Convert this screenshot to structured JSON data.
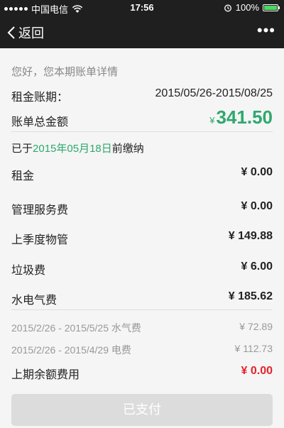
{
  "status_bar": {
    "carrier": "中国电信",
    "time": "17:56",
    "battery_percent": "100%",
    "battery_level": 1.0,
    "icons": [
      "signal-icon",
      "wifi-icon",
      "alarm-icon",
      "battery-icon"
    ]
  },
  "nav": {
    "back_label": "返回",
    "more_label": "•••"
  },
  "bill": {
    "greeting": "您好，您本期账单详情",
    "period_label": "租金账期：",
    "period_value": "2015/05/26-2015/08/25",
    "total_label": "账单总金额",
    "total_currency": "¥",
    "total_amount": "341.50",
    "due_prefix": "已于",
    "due_date": "2015年05月18日",
    "due_suffix": "前缴纳",
    "items": [
      {
        "label": "租金",
        "value": "¥ 0.00"
      },
      {
        "label": "管理服务费",
        "value": "¥ 0.00"
      },
      {
        "label": "上季度物管",
        "value": "¥ 149.88"
      },
      {
        "label": "垃圾费",
        "value": "¥ 6.00"
      },
      {
        "label": "水电气费",
        "value": "¥ 185.62"
      }
    ],
    "sub_items": [
      {
        "label": "2015/2/26 - 2015/5/25 水气费",
        "value": "¥ 72.89"
      },
      {
        "label": "2015/2/26 - 2015/4/29 电费",
        "value": "¥ 112.73"
      }
    ],
    "previous_balance_label": "上期余额费用",
    "previous_balance_value": "¥ 0.00"
  },
  "pay_button_label": "已支付",
  "colors": {
    "accent_green": "#2fa86f",
    "balance_red": "#e8202a",
    "bar_dark": "#1f1f1f",
    "button_disabled": "#dcdcdc"
  }
}
